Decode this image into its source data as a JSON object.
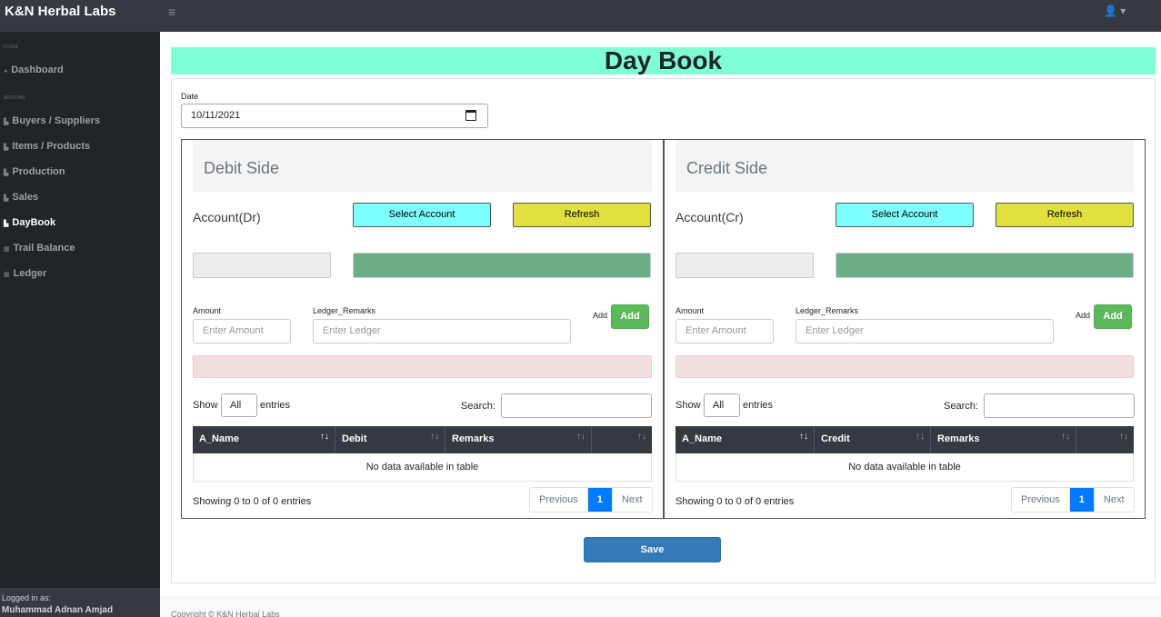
{
  "app": {
    "brand": "K&N Herbal Labs",
    "toggle_icon": "bars-icon",
    "user_icon": "user-icon"
  },
  "sidebar": {
    "heading_core": "Core",
    "heading_addons": "Addons",
    "items": [
      {
        "label": "Dashboard",
        "icon": "gauge-icon",
        "active": false
      },
      {
        "label": "Buyers / Suppliers",
        "icon": "chart-icon",
        "active": false
      },
      {
        "label": "Items / Products",
        "icon": "chart-icon",
        "active": false
      },
      {
        "label": "Production",
        "icon": "chart-icon",
        "active": false
      },
      {
        "label": "Sales",
        "icon": "chart-icon",
        "active": false
      },
      {
        "label": "DayBook",
        "icon": "chart-icon",
        "active": true
      },
      {
        "label": "Trail Balance",
        "icon": "table-icon",
        "active": false
      },
      {
        "label": "Ledger",
        "icon": "table-icon",
        "active": false
      }
    ],
    "footer_label": "Logged in as:",
    "footer_user": "Muhammad Adnan Amjad"
  },
  "page": {
    "title": "Day Book",
    "date_label": "Date",
    "date_value": "10/11/2021",
    "save_label": "Save",
    "footer_text": "Copyright © K&N Herbal Labs"
  },
  "debit": {
    "title": "Debit Side",
    "account_label": "Account(Dr)",
    "select_label": "Select Account",
    "refresh_label": "Refresh",
    "amount_label": "Amount",
    "amount_placeholder": "Enter Amount",
    "ledger_label": "Ledger_Remarks",
    "ledger_placeholder": "Enter Ledger",
    "add_label": "Add",
    "add_button": "Add",
    "show_label": "Show",
    "show_value": "All",
    "entries_label": "entries",
    "search_label": "Search:",
    "columns": [
      "A_Name",
      "Debit",
      "Remarks",
      ""
    ],
    "empty_text": "No data available in table",
    "info_text": "Showing 0 to 0 of 0 entries",
    "prev_label": "Previous",
    "page_label": "1",
    "next_label": "Next"
  },
  "credit": {
    "title": "Credit Side",
    "account_label": "Account(Cr)",
    "select_label": "Select Account",
    "refresh_label": "Refresh",
    "amount_label": "Amount",
    "amount_placeholder": "Enter Amount",
    "ledger_label": "Ledger_Remarks",
    "ledger_placeholder": "Enter Ledger",
    "add_label": "Add",
    "add_button": "Add",
    "show_label": "Show",
    "show_value": "All",
    "entries_label": "entries",
    "search_label": "Search:",
    "columns": [
      "A_Name",
      "Credit",
      "Remarks",
      ""
    ],
    "empty_text": "No data available in table",
    "info_text": "Showing 0 to 0 of 0 entries",
    "prev_label": "Previous",
    "page_label": "1",
    "next_label": "Next"
  },
  "colors": {
    "banner": "#7fffd4",
    "select_button": "#7fffff",
    "refresh_button": "#e0e040",
    "account_name_field": "#6aad87",
    "add_button": "#5cb85c",
    "save_button": "#337ab7",
    "active_page": "#007bff"
  }
}
